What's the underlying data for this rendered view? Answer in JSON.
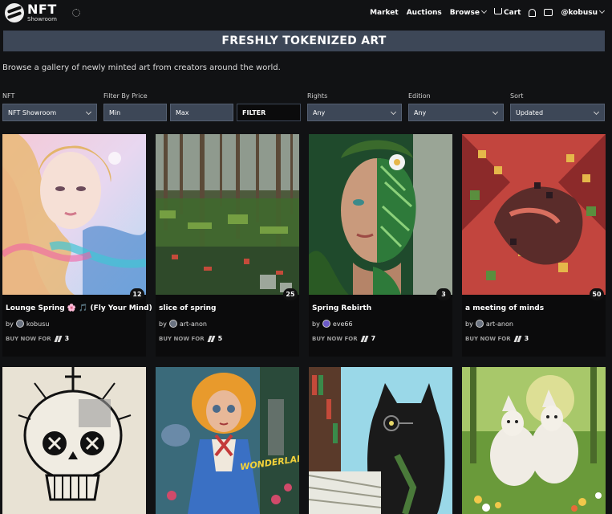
{
  "header": {
    "logo_main": "NFT",
    "logo_sub": "Showroom",
    "nav": {
      "market": "Market",
      "auctions": "Auctions",
      "browse": "Browse",
      "cart": "Cart",
      "user": "@kobusu"
    }
  },
  "banner": {
    "title": "FRESHLY TOKENIZED ART"
  },
  "subtitle": "Browse a gallery of newly minted art from creators around the world.",
  "filters": {
    "nft_label": "NFT",
    "nft_value": "NFT Showroom",
    "price_label": "Filter By Price",
    "min_placeholder": "Min",
    "max_placeholder": "Max",
    "filter_button": "FILTER",
    "rights_label": "Rights",
    "rights_value": "Any",
    "edition_label": "Edition",
    "edition_value": "Any",
    "sort_label": "Sort",
    "sort_value": "Updated"
  },
  "cards": [
    {
      "title": "Lounge Spring 🌸 🎵 (Fly Your Mind)",
      "by": "by",
      "creator": "kobusu",
      "count": "12",
      "buy_label": "BUY NOW FOR",
      "price": "3"
    },
    {
      "title": "slice of spring",
      "by": "by",
      "creator": "art-anon",
      "count": "25",
      "buy_label": "BUY NOW FOR",
      "price": "5"
    },
    {
      "title": "Spring Rebirth",
      "by": "by",
      "creator": "eve66",
      "count": "3",
      "buy_label": "BUY NOW FOR",
      "price": "7"
    },
    {
      "title": "a meeting of minds",
      "by": "by",
      "creator": "art-anon",
      "count": "50",
      "buy_label": "BUY NOW FOR",
      "price": "3"
    }
  ],
  "row2_art_text": {
    "wonderland": "WONDERLAND"
  },
  "colors": {
    "panel": "#3d4757",
    "bg": "#111214",
    "card": "#0b0b0c"
  }
}
